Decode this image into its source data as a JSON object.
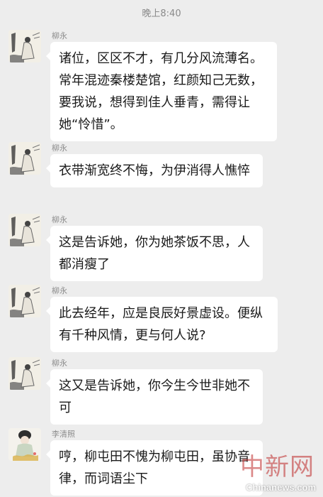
{
  "timestamp": "晚上8:40",
  "messages": [
    {
      "sender": "柳永",
      "text": "诸位，区区不才，有几分风流薄名。常年混迹秦楼楚馆，红颜知己无数，要我说，想得到佳人垂青，需得让她“怜惜”。"
    },
    {
      "sender": "柳永",
      "text": "衣带渐宽终不悔，为伊消得人憔悴"
    },
    {
      "sender": "柳永",
      "text": "这是告诉她，你为她茶饭不思，人都消瘦了"
    },
    {
      "sender": "柳永",
      "text": "此去经年，应是良辰好景虚设。便纵有千种风情，更与何人说?"
    },
    {
      "sender": "柳永",
      "text": "这又是告诉她，你今生今世非她不可"
    },
    {
      "sender": "李清照",
      "text": "哼，柳屯田不愧为柳屯田，虽协音律，而词语尘下"
    }
  ],
  "watermark": {
    "cn": "中新网",
    "en": "Chinanews.com"
  },
  "colors": {
    "background": "#ededed",
    "bubble": "#ffffff"
  },
  "icons": {
    "avatar_liu": "ink-painting-scholar",
    "avatar_li": "ink-painting-lady"
  }
}
